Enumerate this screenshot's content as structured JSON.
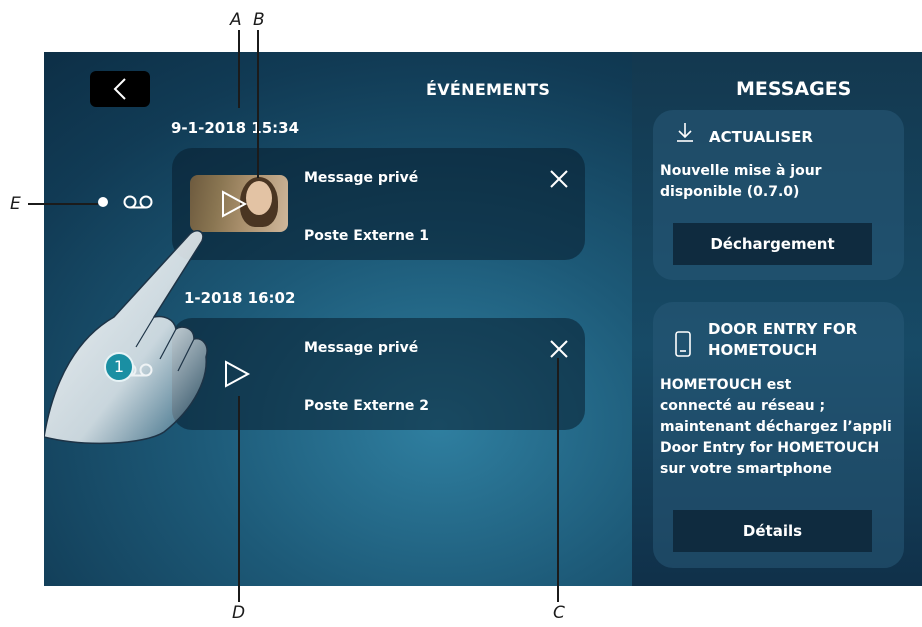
{
  "annotations": {
    "a": "A",
    "b": "B",
    "c": "C",
    "d": "D",
    "e": "E"
  },
  "header": {
    "events_title": "ÉVÉNEMENTS",
    "messages_title": "MESSAGES"
  },
  "events": [
    {
      "date": "9-1-2018  15:34",
      "title": "Message privé",
      "source": "Poste Externe 1"
    },
    {
      "date": "1-2018  16:02",
      "title": "Message privé",
      "source": "Poste Externe 2"
    }
  ],
  "badge": "1",
  "update_card": {
    "title": "ACTUALISER",
    "text_line1": "Nouvelle mise à jour",
    "text_line2": "disponible (0.7.0)",
    "button": "Déchargement"
  },
  "door_card": {
    "title_line1": "DOOR ENTRY FOR",
    "title_line2": "HOMETOUCH",
    "text_line1": "HOMETOUCH est",
    "text_line2": "connecté au réseau ;",
    "text_line3": "maintenant déchargez l’appli",
    "text_line4": "Door Entry for HOMETOUCH",
    "text_line5": "sur votre smartphone",
    "button": "Détails"
  },
  "colors": {
    "screen_bg": "#1d5a78",
    "card_bg": "#0b2638",
    "button_bg": "#0f2b3f",
    "badge": "#1a8fa3"
  }
}
